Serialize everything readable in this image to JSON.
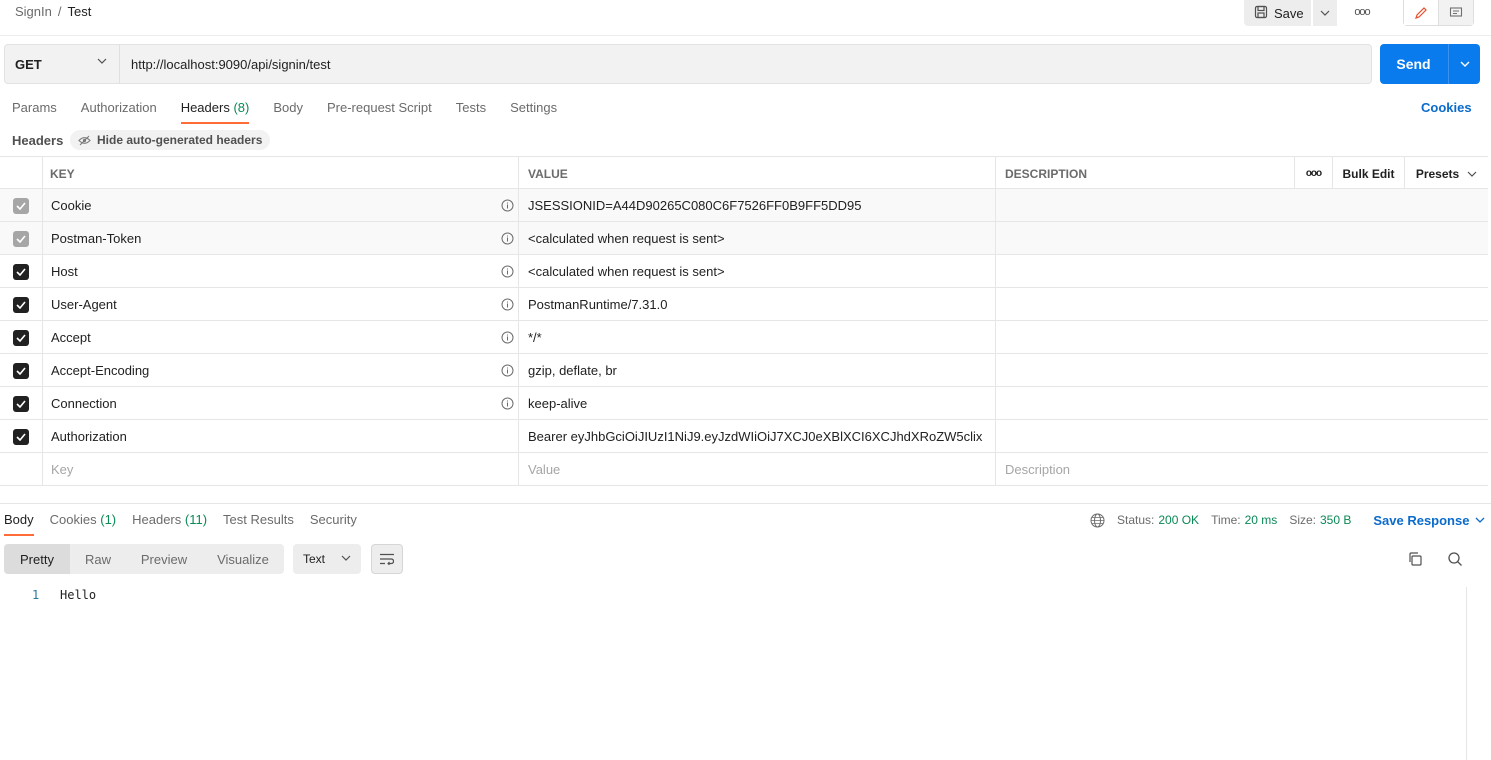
{
  "breadcrumb": {
    "parent": "SignIn",
    "separator": "/",
    "current": "Test"
  },
  "top_actions": {
    "save_label": "Save",
    "more": "ooo"
  },
  "request": {
    "method": "GET",
    "url": "http://localhost:9090/api/signin/test",
    "send_label": "Send"
  },
  "request_tabs": [
    {
      "label": "Params",
      "count": ""
    },
    {
      "label": "Authorization",
      "count": ""
    },
    {
      "label": "Headers",
      "count": "(8)"
    },
    {
      "label": "Body",
      "count": ""
    },
    {
      "label": "Pre-request Script",
      "count": ""
    },
    {
      "label": "Tests",
      "count": ""
    },
    {
      "label": "Settings",
      "count": ""
    }
  ],
  "cookies_link": "Cookies",
  "headers_section": {
    "label": "Headers",
    "hide_auto_label": "Hide auto-generated headers"
  },
  "table": {
    "columns": {
      "key": "KEY",
      "value": "VALUE",
      "description": "DESCRIPTION"
    },
    "actions": {
      "more": "ooo",
      "bulk_edit": "Bulk Edit",
      "presets": "Presets"
    },
    "rows": [
      {
        "key": "Cookie",
        "value": "JSESSIONID=A44D90265C080C6F7526FF0B9FF5DD95",
        "description": ""
      },
      {
        "key": "Postman-Token",
        "value": "<calculated when request is sent>",
        "description": ""
      },
      {
        "key": "Host",
        "value": "<calculated when request is sent>",
        "description": ""
      },
      {
        "key": "User-Agent",
        "value": "PostmanRuntime/7.31.0",
        "description": ""
      },
      {
        "key": "Accept",
        "value": "*/*",
        "description": ""
      },
      {
        "key": "Accept-Encoding",
        "value": "gzip, deflate, br",
        "description": ""
      },
      {
        "key": "Connection",
        "value": "keep-alive",
        "description": ""
      },
      {
        "key": "Authorization",
        "value": "Bearer eyJhbGciOiJIUzI1NiJ9.eyJzdWIiOiJ7XCJ0eXBlXCI6XCJhdXRoZW5clix",
        "description": ""
      }
    ],
    "placeholders": {
      "key": "Key",
      "value": "Value",
      "description": "Description"
    }
  },
  "response": {
    "tabs": [
      {
        "label": "Body",
        "count": ""
      },
      {
        "label": "Cookies",
        "count": "(1)"
      },
      {
        "label": "Headers",
        "count": "(11)"
      },
      {
        "label": "Test Results",
        "count": ""
      },
      {
        "label": "Security",
        "count": ""
      }
    ],
    "status_label": "Status:",
    "status_value": "200 OK",
    "time_label": "Time:",
    "time_value": "20 ms",
    "size_label": "Size:",
    "size_value": "350 B",
    "save_response": "Save Response",
    "views": [
      "Pretty",
      "Raw",
      "Preview",
      "Visualize"
    ],
    "format": "Text",
    "body_lines": [
      {
        "n": "1",
        "text": "Hello"
      }
    ]
  },
  "colors": {
    "accent_send": "#097bed",
    "tab_underline": "#ff6c37",
    "count_green": "#0a8a55",
    "link_blue": "#0b6bcb"
  }
}
